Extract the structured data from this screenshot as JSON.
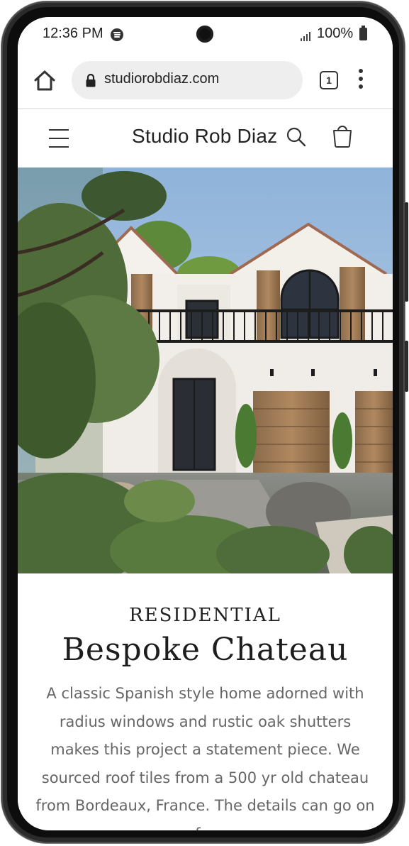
{
  "status_bar": {
    "time": "12:36 PM",
    "battery": "100%"
  },
  "browser": {
    "url": "studiorobdiaz.com",
    "tab_count": "1"
  },
  "site": {
    "brand": "Studio Rob Diaz",
    "hero_alt": "Bespoke Chateau residence exterior",
    "category": "RESIDENTIAL",
    "title": "Bespoke Chateau",
    "description": "A classic Spanish style home adorned with radius windows and rustic oak shutters makes this project a statement piece. We sourced roof tiles from a 500 yr old chateau from Bordeaux, France. The details can go on for"
  },
  "icons": {
    "home": "home-icon",
    "lock": "lock-icon",
    "tabs": "tabs-icon",
    "menu": "more-vert-icon",
    "hamburger": "menu-icon",
    "search": "search-icon",
    "cart": "cart-icon"
  }
}
